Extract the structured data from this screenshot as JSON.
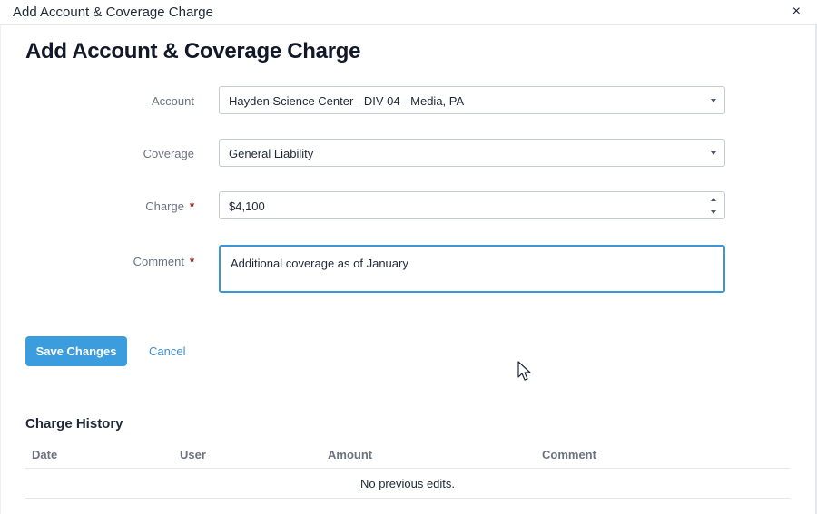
{
  "window": {
    "title": "Add Account & Coverage Charge",
    "close_label": "×"
  },
  "form": {
    "heading": "Add Account & Coverage Charge",
    "account": {
      "label": "Account",
      "value": "Hayden Science Center - DIV-04 - Media, PA"
    },
    "coverage": {
      "label": "Coverage",
      "value": "General Liability"
    },
    "charge": {
      "label": "Charge",
      "required_mark": "*",
      "value": "$4,100"
    },
    "comment": {
      "label": "Comment",
      "required_mark": "*",
      "value": "Additional coverage as of January"
    }
  },
  "actions": {
    "save_label": "Save Changes",
    "cancel_label": "Cancel"
  },
  "history": {
    "title": "Charge History",
    "columns": [
      "Date",
      "User",
      "Amount",
      "Comment"
    ],
    "empty_text": "No previous edits."
  },
  "colors": {
    "accent": "#3b9ddd",
    "focus_border": "#3b97d3",
    "required": "#8b1a1a"
  }
}
